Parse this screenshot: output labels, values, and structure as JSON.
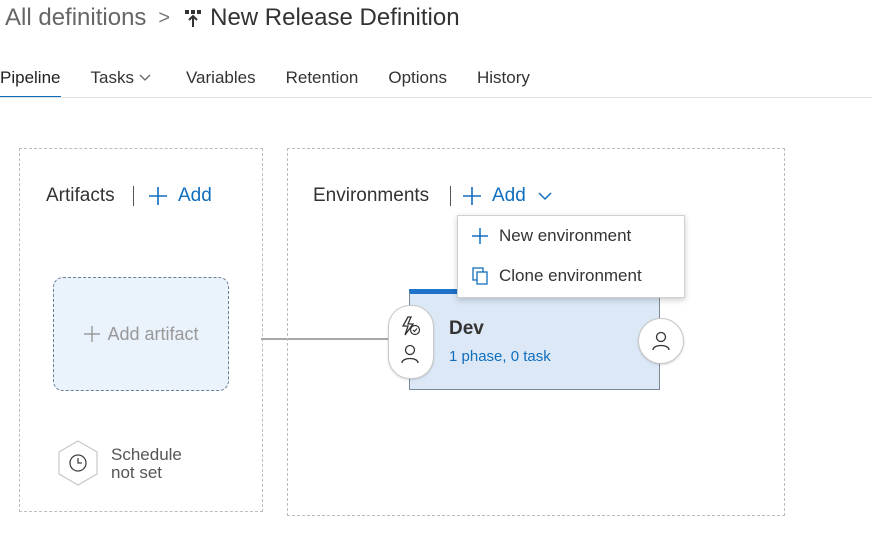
{
  "header": {
    "breadcrumb_root": "All definitions",
    "chevron": ">",
    "title": "New Release Definition"
  },
  "tabs": [
    {
      "label": "Pipeline",
      "active": true
    },
    {
      "label": "Tasks",
      "has_caret": true
    },
    {
      "label": "Variables"
    },
    {
      "label": "Retention"
    },
    {
      "label": "Options"
    },
    {
      "label": "History"
    }
  ],
  "artifacts": {
    "title": "Artifacts",
    "add_label": "Add",
    "add_artifact_label": "Add artifact",
    "schedule_line1": "Schedule",
    "schedule_line2": "not set"
  },
  "environments": {
    "title": "Environments",
    "add_label": "Add",
    "menu": [
      {
        "label": "New environment",
        "icon": "plus-icon"
      },
      {
        "label": "Clone environment",
        "icon": "clone-icon"
      }
    ],
    "env": {
      "name": "Dev",
      "subtitle": "1 phase, 0 task"
    }
  },
  "colors": {
    "accent": "#106ebe",
    "card_bg": "#dce8f6",
    "card_top": "#1e72c8"
  }
}
